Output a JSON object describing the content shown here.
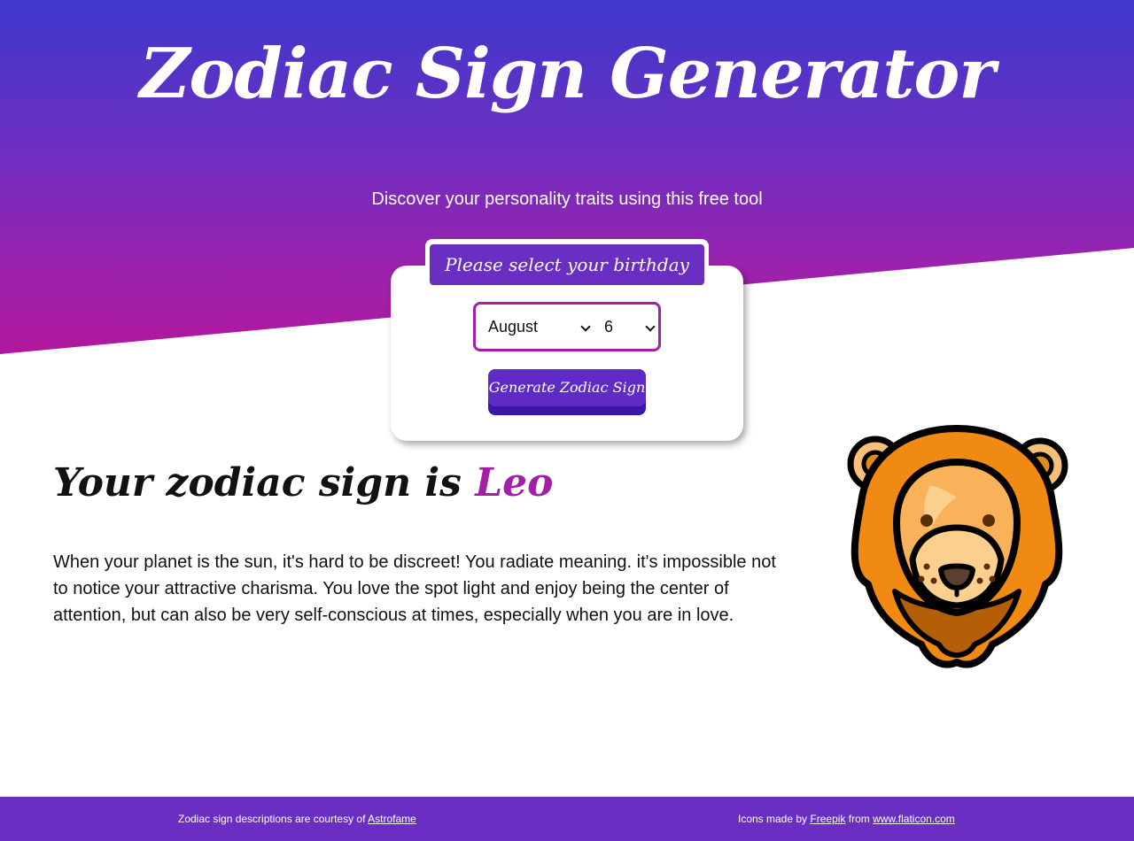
{
  "header": {
    "title": "Zodiac Sign Generator",
    "subtitle": "Discover your personality traits using this free tool"
  },
  "form": {
    "tab_label": "Please select your birthday",
    "month_value": "August",
    "day_value": "6",
    "submit_label": "Generate Zodiac Sign"
  },
  "result": {
    "heading_prefix": "Your zodiac sign is",
    "sign": "Leo",
    "description": "When your planet is the sun, it's hard to be discreet! You radiate meaning. it's impossible not to notice your attractive charisma. You love the spot light and enjoy being the center of attention, but can also be very self-conscious at times, especially when you are in love.",
    "icon": "lion-icon"
  },
  "footer": {
    "credit_prefix": "Zodiac sign descriptions are courtesy of",
    "credit_link": "Astrofame",
    "icons_prefix": "Icons made by",
    "icons_author": "Freepik",
    "icons_from": "from",
    "icons_site": "www.flaticon.com"
  },
  "colors": {
    "gradient_top": "#3e38cc",
    "gradient_bottom": "#b0189d",
    "accent_purple": "#6a2fc2",
    "accent_magenta": "#a21fa6",
    "button_dark": "#3a17a8"
  }
}
